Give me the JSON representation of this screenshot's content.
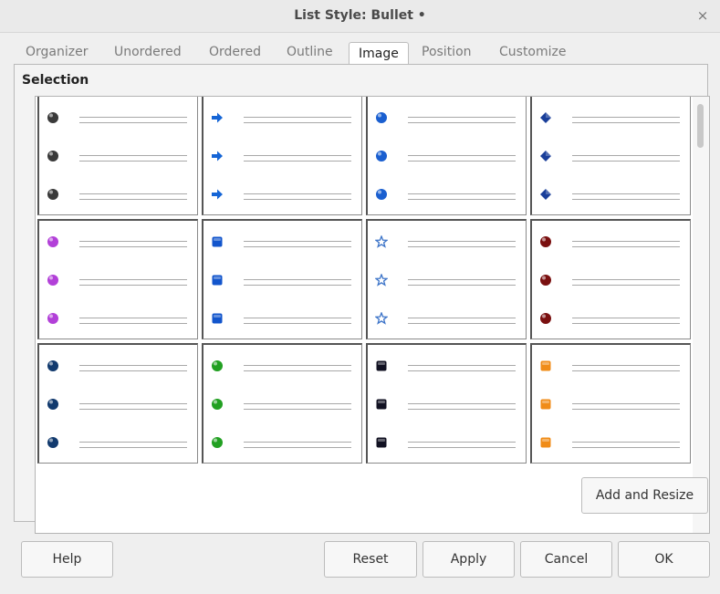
{
  "window": {
    "title": "List Style: Bullet •",
    "close_symbol": "×"
  },
  "tabs": [
    {
      "label": "Organizer"
    },
    {
      "label": "Unordered"
    },
    {
      "label": "Ordered"
    },
    {
      "label": "Outline"
    },
    {
      "label": "Image",
      "active": true
    },
    {
      "label": "Position"
    },
    {
      "label": "Customize"
    }
  ],
  "selection": {
    "label": "Selection",
    "bullets": [
      {
        "icon": "gray-ball-bullet-icon",
        "color": "#3a3a3a"
      },
      {
        "icon": "blue-arrow-bullet-icon",
        "color": "#1565d6"
      },
      {
        "icon": "blue-ball-bullet-icon",
        "color": "#1a5fd0"
      },
      {
        "icon": "blue-diamond-bullet-icon",
        "color": "#1a3f9a"
      },
      {
        "icon": "purple-ball-bullet-icon",
        "color": "#b240d8"
      },
      {
        "icon": "blue-square-bullet-icon",
        "color": "#1255cc"
      },
      {
        "icon": "blue-star-bullet-icon",
        "color": "#3b73c8"
      },
      {
        "icon": "dark-red-ball-bullet-icon",
        "color": "#7a1010"
      },
      {
        "icon": "navy-ball-bullet-icon",
        "color": "#123a6e"
      },
      {
        "icon": "green-ball-bullet-icon",
        "color": "#22a022"
      },
      {
        "icon": "black-square-bullet-icon",
        "color": "#111122"
      },
      {
        "icon": "orange-square-bullet-icon",
        "color": "#f08c18"
      }
    ]
  },
  "buttons": {
    "add_and_resize": "Add and Resize",
    "help": "Help",
    "reset": "Reset",
    "apply": "Apply",
    "cancel": "Cancel",
    "ok": "OK"
  }
}
